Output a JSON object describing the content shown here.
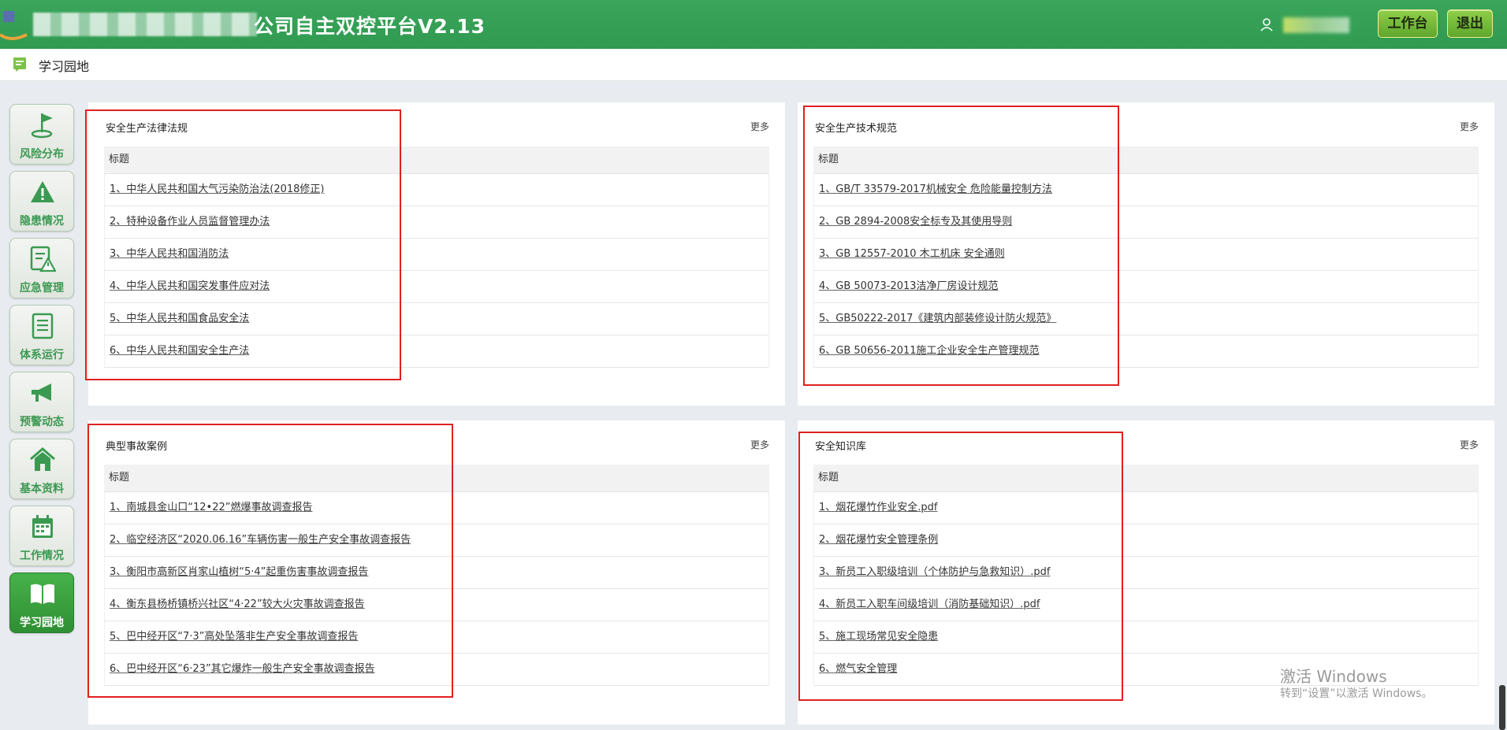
{
  "header": {
    "app_title": "公司自主双控平台V2.13",
    "workbench_label": "工作台",
    "logout_label": "退出",
    "user_icon": "user-icon",
    "brand_color": "#35a157"
  },
  "breadcrumb": {
    "label": "学习园地",
    "icon": "document-icon"
  },
  "sidebar": {
    "items": [
      {
        "label": "风险分布",
        "icon": "golf-flag-icon"
      },
      {
        "label": "隐患情况",
        "icon": "warning-icon"
      },
      {
        "label": "应急管理",
        "icon": "doc-warning-icon"
      },
      {
        "label": "体系运行",
        "icon": "document-list-icon"
      },
      {
        "label": "预警动态",
        "icon": "megaphone-icon"
      },
      {
        "label": "基本资料",
        "icon": "home-icon"
      },
      {
        "label": "工作情况",
        "icon": "calendar-icon"
      },
      {
        "label": "学习园地",
        "icon": "book-icon",
        "active": true
      }
    ]
  },
  "panels": {
    "laws": {
      "title": "安全生产法律法规",
      "more": "更多",
      "header": "标题",
      "rows": [
        "1、中华人民共和国大气污染防治法(2018修正)",
        "2、特种设备作业人员监督管理办法",
        "3、中华人民共和国消防法",
        "4、中华人民共和国突发事件应对法",
        "5、中华人民共和国食品安全法",
        "6、中华人民共和国安全生产法"
      ]
    },
    "standards": {
      "title": "安全生产技术规范",
      "more": "更多",
      "header": "标题",
      "rows": [
        "1、GB/T 33579-2017机械安全 危险能量控制方法",
        "2、GB 2894-2008安全标专及其使用导则",
        "3、GB 12557-2010 木工机床 安全通则",
        "4、GB 50073-2013洁净厂房设计规范",
        "5、GB50222-2017《建筑内部装修设计防火规范》",
        "6、GB 50656-2011施工企业安全生产管理规范"
      ]
    },
    "cases": {
      "title": "典型事故案例",
      "more": "更多",
      "header": "标题",
      "rows": [
        "1、南城县金山口“12•22”燃爆事故调查报告",
        "2、临空经济区“2020.06.16”车辆伤害一般生产安全事故调查报告",
        "3、衡阳市高新区肖家山植树“5·4”起重伤害事故调查报告",
        "4、衡东县杨桥镇桥兴社区“4·22”较大火灾事故调查报告",
        "5、巴中经开区“7·3”高处坠落非生产安全事故调查报告",
        "6、巴中经开区“6·23”其它爆炸一般生产安全事故调查报告"
      ]
    },
    "knowledge": {
      "title": "安全知识库",
      "more": "更多",
      "header": "标题",
      "rows": [
        "1、烟花爆竹作业安全.pdf",
        "2、烟花爆竹安全管理条例",
        "3、新员工入职级培训（个体防护与急救知识）.pdf",
        "4、新员工入职车间级培训（消防基础知识）.pdf",
        "5、施工现场常见安全隐患",
        "6、燃气安全管理"
      ]
    }
  },
  "watermark": {
    "line1": "激活 Windows",
    "line2": "转到“设置”以激活 Windows。"
  }
}
